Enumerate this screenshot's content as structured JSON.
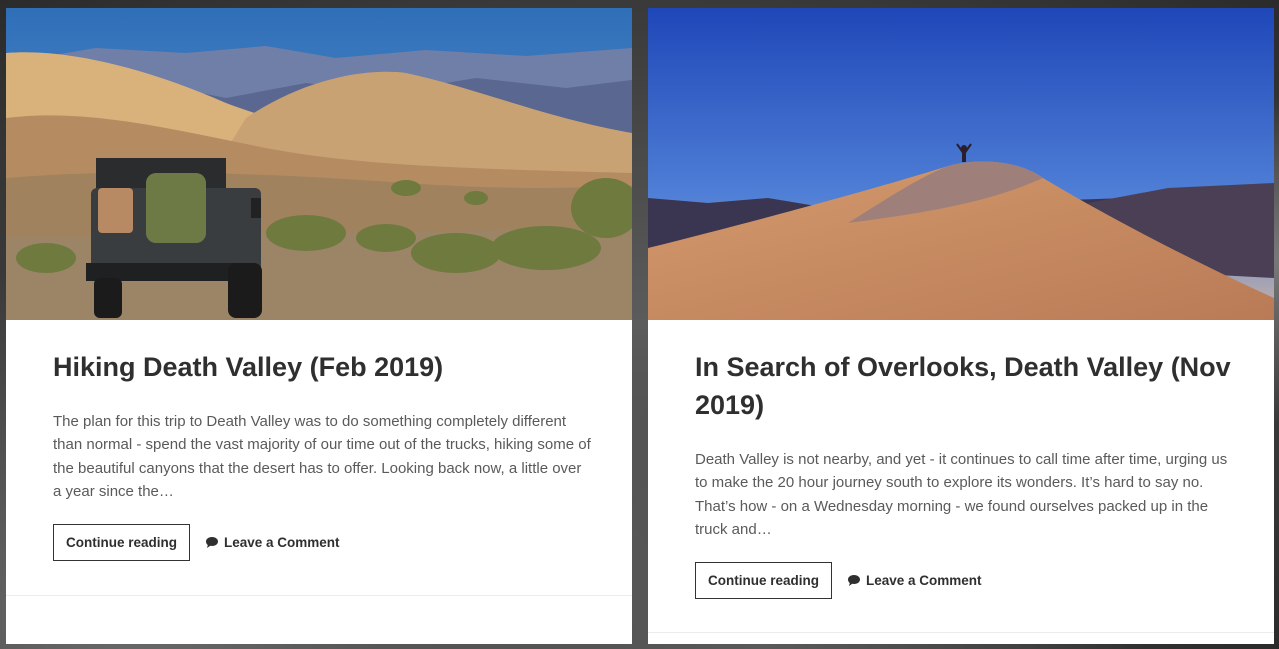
{
  "posts": [
    {
      "title": "Hiking Death Valley (Feb 2019)",
      "excerpt": "The plan for this trip to Death Valley was to do something completely different than normal - spend the vast majority of our time out of the trucks, hiking some of the beautiful canyons that the desert has to offer. Looking back now, a little over a year since the…",
      "continue_label": "Continue reading",
      "comment_label": "Leave a Comment",
      "comment_icon": "speech-bubble-icon"
    },
    {
      "title": "In Search of Overlooks, Death Valley (Nov 2019)",
      "excerpt": "Death Valley is not nearby, and yet - it continues to call time after time, urging us to make the 20 hour journey south to explore its wonders. It’s hard to say no. That’s how - on a Wednesday morning - we found ourselves packed up in the truck and…",
      "continue_label": "Continue reading",
      "comment_label": "Leave a Comment",
      "comment_icon": "speech-bubble-icon"
    }
  ],
  "colors": {
    "title": "#2f2f2f",
    "excerpt": "#5a5a5a",
    "card_bg": "#ffffff"
  }
}
